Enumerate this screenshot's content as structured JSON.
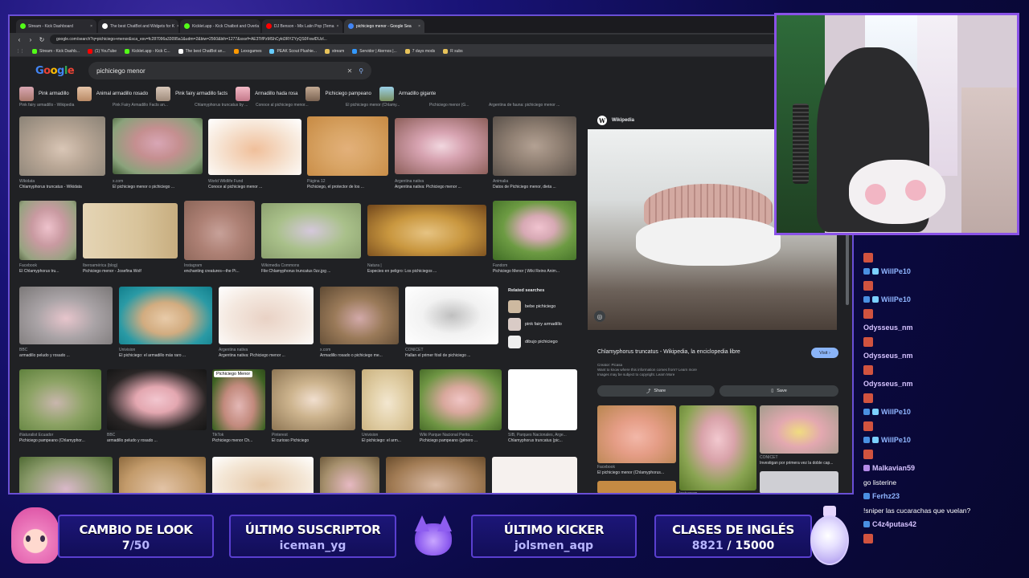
{
  "browser": {
    "tabs": [
      {
        "label": "Stream - Kick Dashboard",
        "color": "#53fc18"
      },
      {
        "label": "The best ChatBot and Widgets for K",
        "color": "#ffffff"
      },
      {
        "label": "Kicklet.app - Kick Chatbot and Overla",
        "color": "#53fc18"
      },
      {
        "label": "DJ Benson - Mix Latin Pop (Tema",
        "color": "#ff0000"
      },
      {
        "label": "pichiciego menor - Google Sea",
        "color": "#4285f4"
      }
    ],
    "url": "google.com/search?q=pichiciego+menor&sca_esv=fc287096a33095a1&udm=2&biw=2560&bih=1277&sxsrf=AE3TifPzMShCykt3RYZYyQS0FxwlDUzl...",
    "bookmarks": [
      "Stream - Kick Dashb...",
      "(1) YouTube",
      "Kicklet.app - Kick C...",
      "The best ChatBot an...",
      "Lexogames",
      "PEAK Scout Plushie...",
      "stream",
      "Servidor | Aternos |...",
      "7 days mods",
      "R subs"
    ],
    "nav_icons": [
      "back-icon",
      "forward-icon",
      "reload-icon"
    ]
  },
  "google": {
    "logo": "Google",
    "query": "pichiciego menor",
    "chips": [
      "Pink armadillo",
      "Animal armadillo rosado",
      "Pink fairy armadillo facts",
      "Armadillo hada rosa",
      "Pichiciego pampeano",
      "Armadillo gigante"
    ]
  },
  "results": {
    "top_partial": [
      "Pink fairy armadillo - Wikipedia",
      "Pink Fairy Armadillo Facts an...",
      "Chlamyphorus truncatus by ...",
      "Conoce al pichiciego menor...",
      "El pichiciego menor (Chlamy...",
      "Pichiciego menor (G...",
      "Argentina de fauna: pichiciego menor ..."
    ],
    "row1": [
      {
        "src": "Wikidata",
        "title": "Chlamyphorus truncatus - Wikidata"
      },
      {
        "src": "x.com",
        "title": "El pichiciego menor o pichiciego ..."
      },
      {
        "src": "World Wildlife Fund",
        "title": "Conoce al pichiciego menor ..."
      },
      {
        "src": "Página 12",
        "title": "Pichiciego, el protector de los ..."
      },
      {
        "src": "Argentina nativa",
        "title": "Argentina nativa: Pichiciego menor ..."
      },
      {
        "src": "Animalia",
        "title": "Datos de Pichiciego menor, dieta ..."
      }
    ],
    "row2": [
      {
        "src": "Facebook",
        "title": "El Chlamyphorus tru..."
      },
      {
        "src": "Iberoamérica (blog)",
        "title": "Pichiciego menor - Josefina Wolf"
      },
      {
        "src": "Instagram",
        "title": "enchanting creatures—the Pi..."
      },
      {
        "src": "Wikimedia Commons",
        "title": "File:Chlamyphorus truncatus 0zz.jpg ..."
      },
      {
        "src": "Natura |",
        "title": "Especies en peligro: Los pichiciegos ..."
      },
      {
        "src": "Fandom",
        "title": "Pichiciego Menor | Wiki Reino Anim..."
      }
    ],
    "row3": [
      {
        "src": "BBC",
        "title": "armadillo peludo y rosado ..."
      },
      {
        "src": "Univision",
        "title": "El pichiciego: el armadillo más raro ..."
      },
      {
        "src": "Argentina nativa",
        "title": "Argentina nativa: Pichiciego menor ..."
      },
      {
        "src": "x.com",
        "title": "Armadillo rosado o pichiciego me..."
      },
      {
        "src": "CONICET",
        "title": "Hallan el primer fósil de pichiciego ..."
      }
    ],
    "related": {
      "heading": "Related searches",
      "items": [
        "bebe pichiciego",
        "pink fairy armadillo",
        "dibujo pichiciego"
      ]
    },
    "row4": [
      {
        "src": "iNaturalist Ecuador",
        "title": "Pichiciego pampeano (Chlamyphor..."
      },
      {
        "src": "BBC",
        "title": "armadillo peludo y rosado ..."
      },
      {
        "src": "TikTok",
        "title": "Pichiciego menor Ch..."
      },
      {
        "src": "Pinterest",
        "title": "El curioso Pichiciego"
      },
      {
        "src": "Univision",
        "title": "El pichiciego: el arm..."
      },
      {
        "src": "Wiki Parque Nacional Perito...",
        "title": "Pichiciego pampeano (género ..."
      },
      {
        "src": "SIB, Parques Nacionales, Arge...",
        "title": "Chlamyphorus truncatus (pic..."
      }
    ],
    "badge_label": "Pichiciego Menor"
  },
  "panel": {
    "source": "Wikipedia",
    "title": "Chlamyphorus truncatus - Wikipedia, la enciclopedia libre",
    "visit": "Visit",
    "credit": "Creator: Picasa",
    "note1": "Want to know where this information comes from? Learn more",
    "note2": "Images may be subject to copyright. Learn More",
    "share": "Share",
    "save": "Save",
    "more": [
      {
        "src": "Facebook",
        "title": "El pichiciego menor (Chlamyphorus..."
      },
      {
        "src": "Instagram",
        "title": "Pichiciego menor (Chlamyphorus..."
      },
      {
        "src": "CONICET",
        "title": "Investigan por primera vez la doble cap..."
      }
    ]
  },
  "chat": [
    {
      "type": "emote"
    },
    {
      "type": "user",
      "name": "WillPe10",
      "style": "name"
    },
    {
      "type": "emote"
    },
    {
      "type": "user",
      "name": "WillPe10",
      "style": "name"
    },
    {
      "type": "emote"
    },
    {
      "type": "user",
      "name": "Odysseus_nm",
      "style": "name2"
    },
    {
      "type": "emote"
    },
    {
      "type": "user",
      "name": "Odysseus_nm",
      "style": "name2"
    },
    {
      "type": "emote"
    },
    {
      "type": "user",
      "name": "Odysseus_nm",
      "style": "name2"
    },
    {
      "type": "emote"
    },
    {
      "type": "user",
      "name": "WillPe10",
      "style": "name"
    },
    {
      "type": "emote"
    },
    {
      "type": "user",
      "name": "WillPe10",
      "style": "name"
    },
    {
      "type": "emote"
    },
    {
      "type": "user",
      "name": "Malkavian59",
      "style": "name2"
    },
    {
      "type": "msg",
      "text": "go listerine"
    },
    {
      "type": "user",
      "name": "Ferhz23",
      "style": "name"
    },
    {
      "type": "msg",
      "text": "!sniper las cucarachas que vuelan?"
    },
    {
      "type": "user",
      "name": "C4z4putas42",
      "style": "name2"
    },
    {
      "type": "emote"
    }
  ],
  "overlay": {
    "look": {
      "title": "CAMBIO DE LOOK",
      "current": "7",
      "total": "/50"
    },
    "sub": {
      "title": "ÚLTIMO SUSCRIPTOR",
      "value": "iceman_yg"
    },
    "kicker": {
      "title": "ÚLTIMO KICKER",
      "value": "jolsmen_aqp"
    },
    "english": {
      "title": "CLASES DE INGLÉS",
      "current": "8821",
      "total": " / 15000"
    }
  },
  "colors": {
    "accent": "#6a4fd6",
    "frame": "#8a52e8",
    "link": "#8ab4f8"
  }
}
